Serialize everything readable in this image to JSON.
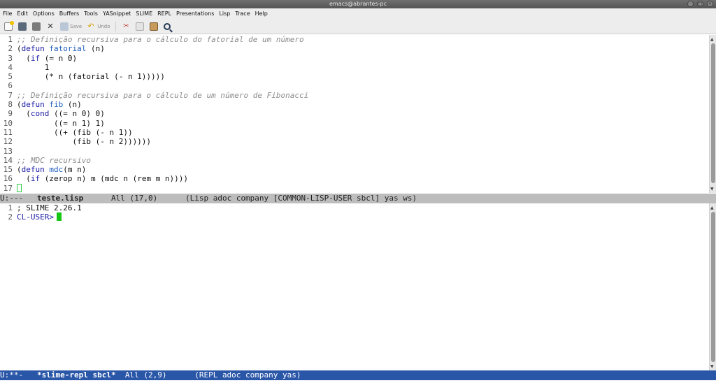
{
  "window": {
    "title": "emacs@abrantes-pc"
  },
  "menu": [
    "File",
    "Edit",
    "Options",
    "Buffers",
    "Tools",
    "YASnippet",
    "SLIME",
    "REPL",
    "Presentations",
    "Lisp",
    "Trace",
    "Help"
  ],
  "toolbar": {
    "save_label": "Save",
    "undo_label": "Undo"
  },
  "editor": {
    "lines": [
      {
        "n": "1",
        "segs": [
          {
            "t": ";; Definição recursiva para o cálculo do fatorial de um número",
            "c": "comment"
          }
        ]
      },
      {
        "n": "2",
        "segs": [
          {
            "t": "(",
            "c": "code"
          },
          {
            "t": "defun",
            "c": "kw"
          },
          {
            "t": " ",
            "c": "code"
          },
          {
            "t": "fatorial",
            "c": "fn"
          },
          {
            "t": " (n)",
            "c": "code"
          }
        ]
      },
      {
        "n": "3",
        "segs": [
          {
            "t": "  (",
            "c": "code"
          },
          {
            "t": "if",
            "c": "kw"
          },
          {
            "t": " (= n 0)",
            "c": "code"
          }
        ]
      },
      {
        "n": "4",
        "segs": [
          {
            "t": "      1",
            "c": "code"
          }
        ]
      },
      {
        "n": "5",
        "segs": [
          {
            "t": "      (* n (fatorial (- n 1)))))",
            "c": "code"
          }
        ]
      },
      {
        "n": "6",
        "segs": []
      },
      {
        "n": "7",
        "segs": [
          {
            "t": ";; Definição recursiva para o cálculo de um número de Fibonacci",
            "c": "comment"
          }
        ]
      },
      {
        "n": "8",
        "segs": [
          {
            "t": "(",
            "c": "code"
          },
          {
            "t": "defun",
            "c": "kw"
          },
          {
            "t": " ",
            "c": "code"
          },
          {
            "t": "fib",
            "c": "fn"
          },
          {
            "t": " (n)",
            "c": "code"
          }
        ]
      },
      {
        "n": "9",
        "segs": [
          {
            "t": "  (",
            "c": "code"
          },
          {
            "t": "cond",
            "c": "kw"
          },
          {
            "t": " ((= n 0) 0)",
            "c": "code"
          }
        ]
      },
      {
        "n": "10",
        "segs": [
          {
            "t": "        ((= n 1) 1)",
            "c": "code"
          }
        ]
      },
      {
        "n": "11",
        "segs": [
          {
            "t": "        ((+ (fib (- n 1))",
            "c": "code"
          }
        ]
      },
      {
        "n": "12",
        "segs": [
          {
            "t": "            (fib (- n 2))))))",
            "c": "code"
          }
        ]
      },
      {
        "n": "13",
        "segs": []
      },
      {
        "n": "14",
        "segs": [
          {
            "t": ";; MDC recursivo",
            "c": "comment"
          }
        ]
      },
      {
        "n": "15",
        "segs": [
          {
            "t": "(",
            "c": "code"
          },
          {
            "t": "defun",
            "c": "kw"
          },
          {
            "t": " ",
            "c": "code"
          },
          {
            "t": "mdc",
            "c": "fn"
          },
          {
            "t": "(m n)",
            "c": "code"
          }
        ]
      },
      {
        "n": "16",
        "segs": [
          {
            "t": "  (",
            "c": "code"
          },
          {
            "t": "if",
            "c": "kw"
          },
          {
            "t": " (zerop n) m (mdc n (rem m n))))",
            "c": "code"
          }
        ]
      },
      {
        "n": "17",
        "segs": [],
        "cursor": true
      }
    ]
  },
  "modeline_top": {
    "status": "U:---",
    "buffer": "teste.lisp",
    "position": "All (17,0)",
    "modes": "(Lisp adoc company [COMMON-LISP-USER sbcl] yas ws)"
  },
  "repl": {
    "line1_num": "1",
    "line1": "; SLIME 2.26.1",
    "line2_num": "2",
    "prompt": "CL-USER>"
  },
  "modeline_bottom": {
    "status": "U:**-",
    "buffer": "*slime-repl sbcl*",
    "position": "All (2,9)",
    "modes": "(REPL adoc company yas)"
  },
  "colors": {
    "modeline_active": "#2a56a8",
    "modeline_inactive": "#bdbdbd",
    "keyword": "#1a1aa6",
    "function_name": "#1f5fbf",
    "comment": "#8c8c8c",
    "cursor": "#16c716"
  }
}
